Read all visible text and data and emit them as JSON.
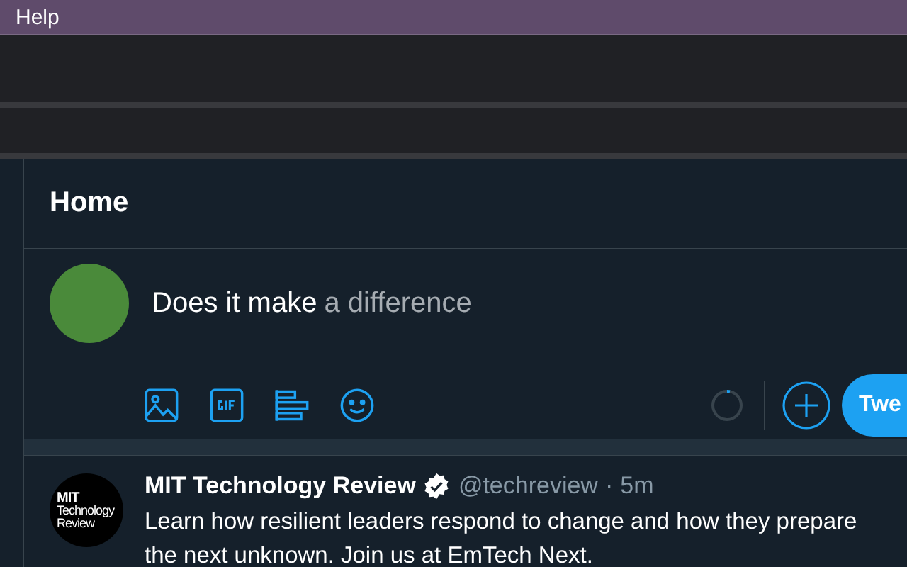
{
  "menu_bar": {
    "items": [
      "Help"
    ]
  },
  "header": {
    "title": "Home"
  },
  "composer": {
    "text": "Does it make",
    "suggestion": "a difference",
    "tweet_button": "Twe"
  },
  "tweet": {
    "logo_text": [
      "MIT",
      "Technology",
      "Review"
    ],
    "name": "MIT Technology Review",
    "verified": true,
    "handle": "@techreview",
    "separator": "·",
    "time": "5m",
    "body_lines": [
      "Learn how resilient leaders respond to change and how they prepare",
      "the next unknown. Join us at EmTech Next."
    ]
  }
}
